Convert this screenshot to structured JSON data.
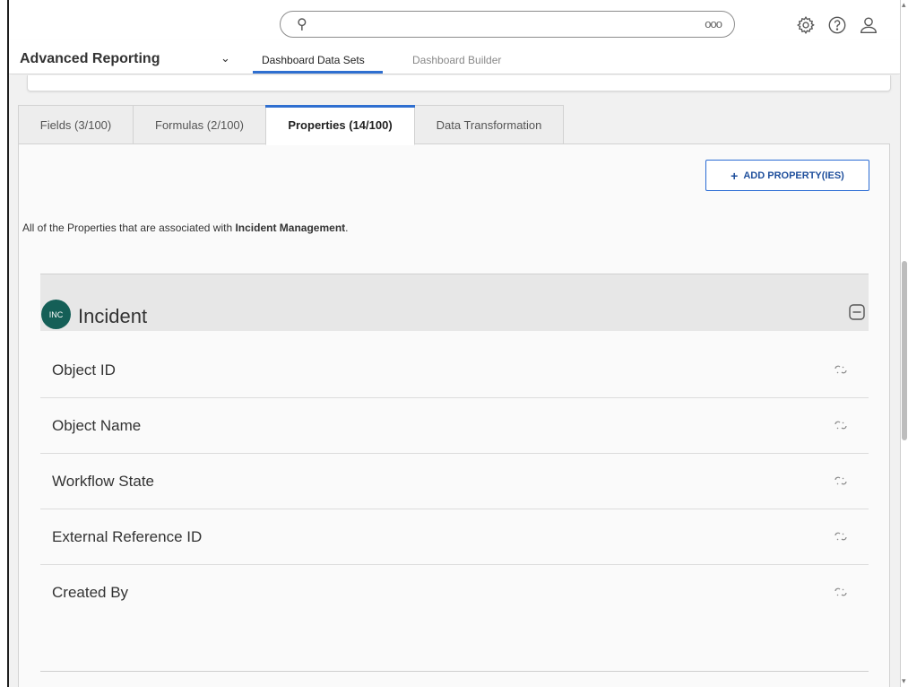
{
  "search": {
    "icon": "search-icon",
    "more_label": "ooo"
  },
  "header_icons": [
    "gear-icon",
    "help-icon",
    "user-icon"
  ],
  "app": {
    "title": "Advanced Reporting",
    "caret": "⌄"
  },
  "nav": {
    "tabs": [
      {
        "label": "Dashboard Data Sets",
        "active": true
      },
      {
        "label": "Dashboard Builder",
        "active": false
      }
    ]
  },
  "tabs": [
    {
      "label": "Fields (3/100)",
      "active": false
    },
    {
      "label": "Formulas (2/100)",
      "active": false
    },
    {
      "label": "Properties (14/100)",
      "active": true
    },
    {
      "label": "Data Transformation",
      "active": false
    }
  ],
  "add_button": {
    "plus": "+",
    "label": "ADD PROPERTY(IES)"
  },
  "description": {
    "prefix": "All of the Properties that are associated with ",
    "bold": "Incident Management",
    "suffix": "."
  },
  "group": {
    "badge": "INC",
    "title": "Incident",
    "properties": [
      {
        "label": "Object ID",
        "icon": "unlink-icon"
      },
      {
        "label": "Object Name",
        "icon": "unlink-icon"
      },
      {
        "label": "Workflow State",
        "icon": "unlink-icon"
      },
      {
        "label": "External Reference ID",
        "icon": "unlink-icon"
      },
      {
        "label": "Created By",
        "icon": "unlink-icon"
      }
    ]
  },
  "colors": {
    "accent": "#2f6fd0",
    "badge": "#155f57",
    "button_text": "#1f4f9c"
  }
}
